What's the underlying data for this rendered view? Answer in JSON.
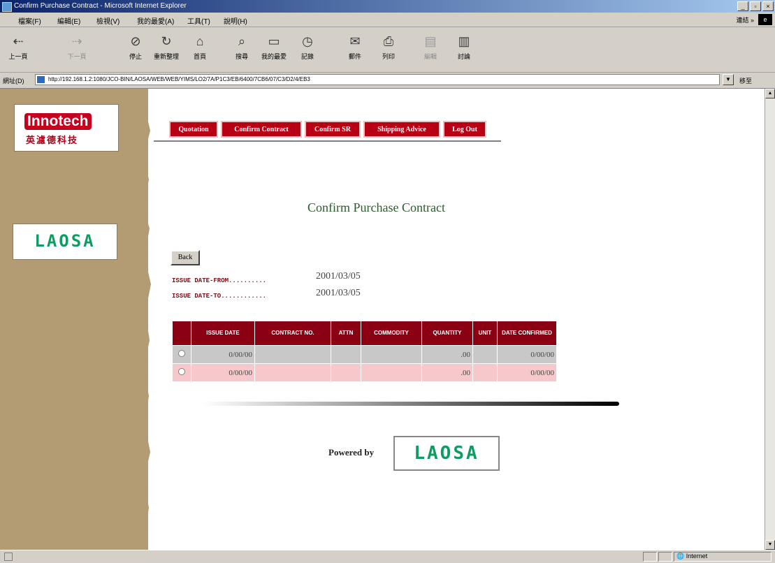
{
  "window": {
    "title": "Confirm Purchase Contract - Microsoft Internet Explorer",
    "buttons": [
      "_",
      "▫",
      "×"
    ]
  },
  "menubar": {
    "items": [
      "檔案(F)",
      "編輯(E)",
      "檢視(V)",
      "我的最愛(A)",
      "工具(T)",
      "說明(H)"
    ],
    "links_label": "連結 »"
  },
  "toolbar": {
    "buttons": [
      {
        "label": "上一頁",
        "icon": "back-arrow-icon"
      },
      {
        "label": "下一頁",
        "icon": "forward-arrow-icon"
      },
      {
        "label": "停止",
        "icon": "stop-icon"
      },
      {
        "label": "重新整理",
        "icon": "refresh-icon"
      },
      {
        "label": "首頁",
        "icon": "home-icon"
      },
      {
        "label": "搜尋",
        "icon": "search-icon"
      },
      {
        "label": "我的最愛",
        "icon": "favorites-icon"
      },
      {
        "label": "記錄",
        "icon": "history-icon"
      },
      {
        "label": "郵件",
        "icon": "mail-icon"
      },
      {
        "label": "列印",
        "icon": "print-icon"
      },
      {
        "label": "編輯",
        "icon": "edit-icon"
      },
      {
        "label": "討論",
        "icon": "discuss-icon"
      }
    ]
  },
  "addressbar": {
    "label": "網址(D)",
    "url": "http://192.168.1.2:1080/JCO-BIN/LAOSA/WEB/WEB/YIMS/LO2/7A/P1C3/EB/6400/7CB6/07/C3/D2/4/EB3",
    "go_label": "移至"
  },
  "sidebar": {
    "brand": "Innotech",
    "brand_sub": "英濾德科技",
    "partner_logo": "LAOSA"
  },
  "nav": {
    "tabs": [
      "Quotation",
      "Confirm Contract",
      "Confirm SR",
      "Shipping Advice",
      "Log Out"
    ]
  },
  "page": {
    "title": "Confirm Purchase Contract",
    "back_label": "Back",
    "issue_from_label": "ISSUE DATE-FROM..........",
    "issue_from_value": "2001/03/05",
    "issue_to_label": "ISSUE DATE-TO............",
    "issue_to_value": "2001/03/05"
  },
  "table": {
    "headers": [
      "",
      "ISSUE DATE",
      "CONTRACT NO.",
      "ATTN",
      "COMMODITY",
      "QUANTITY",
      "UNIT",
      "DATE CONFIRMED"
    ],
    "rows": [
      {
        "issue_date": "0/00/00",
        "contract_no": "",
        "attn": "",
        "commodity": "",
        "quantity": ".00",
        "unit": "",
        "date_confirmed": "0/00/00"
      },
      {
        "issue_date": "0/00/00",
        "contract_no": "",
        "attn": "",
        "commodity": "",
        "quantity": ".00",
        "unit": "",
        "date_confirmed": "0/00/00"
      }
    ]
  },
  "footer": {
    "powered_label": "Powered by",
    "logo": "LAOSA"
  },
  "status": {
    "zone": "Internet"
  }
}
